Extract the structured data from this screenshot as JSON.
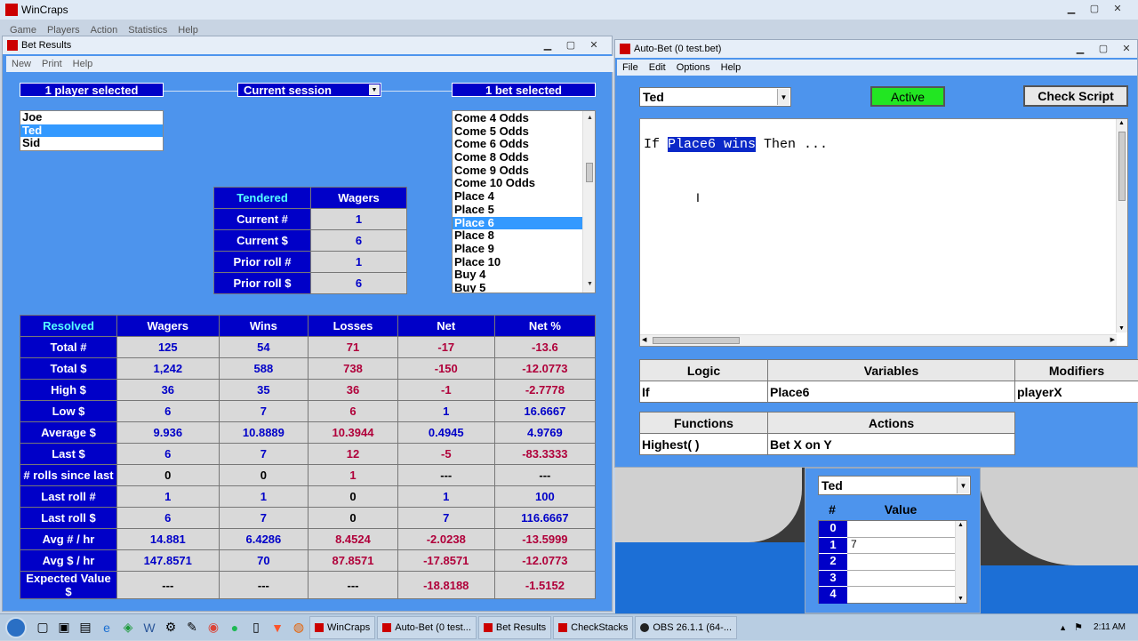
{
  "app": {
    "title": "WinCraps",
    "menu": [
      "Game",
      "Players",
      "Action",
      "Statistics",
      "Help"
    ]
  },
  "bet_results": {
    "title": "Bet Results",
    "menu": [
      "New",
      "Print",
      "Help"
    ],
    "players_header": "1 player selected",
    "session": "Current session",
    "bets_header": "1 bet selected",
    "players": [
      "Joe",
      "Ted",
      "Sid"
    ],
    "selected_player": "Ted",
    "bets": [
      "Come 4 Odds",
      "Come 5 Odds",
      "Come 6 Odds",
      "Come 8 Odds",
      "Come 9 Odds",
      "Come 10 Odds",
      "Place 4",
      "Place 5",
      "Place 6",
      "Place 8",
      "Place 9",
      "Place 10",
      "Buy 4",
      "Buy 5"
    ],
    "selected_bet": "Place 6",
    "tendered": {
      "headers": [
        "Tendered",
        "Wagers"
      ],
      "rows": [
        [
          "Current #",
          "1"
        ],
        [
          "Current $",
          "6"
        ],
        [
          "Prior roll #",
          "1"
        ],
        [
          "Prior roll $",
          "6"
        ]
      ]
    },
    "resolved": {
      "headers": [
        "Resolved",
        "Wagers",
        "Wins",
        "Losses",
        "Net",
        "Net %"
      ],
      "rows": [
        [
          "Total #",
          "125",
          "54",
          "71",
          "-17",
          "-13.6"
        ],
        [
          "Total $",
          "1,242",
          "588",
          "738",
          "-150",
          "-12.0773"
        ],
        [
          "High $",
          "36",
          "35",
          "36",
          "-1",
          "-2.7778"
        ],
        [
          "Low $",
          "6",
          "7",
          "6",
          "1",
          "16.6667"
        ],
        [
          "Average $",
          "9.936",
          "10.8889",
          "10.3944",
          "0.4945",
          "4.9769"
        ],
        [
          "Last $",
          "6",
          "7",
          "12",
          "-5",
          "-83.3333"
        ],
        [
          "# rolls since last",
          "0",
          "0",
          "1",
          "---",
          "---"
        ],
        [
          "Last roll #",
          "1",
          "1",
          "0",
          "1",
          "100"
        ],
        [
          "Last roll $",
          "6",
          "7",
          "0",
          "7",
          "116.6667"
        ],
        [
          "Avg # / hr",
          "14.881",
          "6.4286",
          "8.4524",
          "-2.0238",
          "-13.5999"
        ],
        [
          "Avg $ / hr",
          "147.8571",
          "70",
          "87.8571",
          "-17.8571",
          "-12.0773"
        ],
        [
          "Expected Value $",
          "---",
          "---",
          "---",
          "-18.8188",
          "-1.5152"
        ]
      ]
    }
  },
  "auto_bet": {
    "title": "Auto-Bet (0 test.bet)",
    "menu": [
      "File",
      "Edit",
      "Options",
      "Help"
    ],
    "player": "Ted",
    "active_label": "Active",
    "check_label": "Check Script",
    "script_if": "If ",
    "script_sel": "Place6 wins",
    "script_then": " Then ...",
    "grid1_headers": [
      "Logic",
      "Variables",
      "Modifiers"
    ],
    "grid1_row": [
      "If",
      "Place6",
      "playerX"
    ],
    "grid2_headers": [
      "Functions",
      "Actions"
    ],
    "grid2_row": [
      "Highest( )",
      "Bet X on Y"
    ]
  },
  "checkstacks": {
    "player": "Ted",
    "col_num": "#",
    "col_value": "Value",
    "rows": [
      [
        "0",
        ""
      ],
      [
        "1",
        "7"
      ],
      [
        "2",
        ""
      ],
      [
        "3",
        ""
      ],
      [
        "4",
        ""
      ]
    ]
  },
  "taskbar": {
    "items": [
      "WinCraps",
      "Auto-Bet (0 test...",
      "Bet Results",
      "CheckStacks",
      "OBS 26.1.1 (64-..."
    ],
    "time": "2:11 AM"
  }
}
